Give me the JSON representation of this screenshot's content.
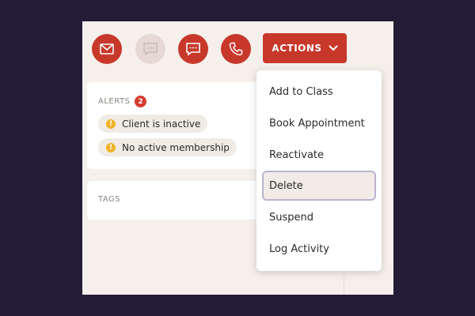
{
  "toolbar": {
    "actions_label": "ACTIONS",
    "sms_label": "SMS",
    "icons": [
      "envelope-icon",
      "sms-icon",
      "chat-icon",
      "phone-icon",
      "chevron-down-icon"
    ],
    "accent_color": "#c8382a"
  },
  "alerts": {
    "label": "ALERTS",
    "count": "2",
    "items": [
      "Client is inactive",
      "No active membership"
    ]
  },
  "tags": {
    "label": "TAGS"
  },
  "menu": {
    "items": [
      "Add to Class",
      "Book Appointment",
      "Reactivate",
      "Delete",
      "Suspend",
      "Log Activity"
    ],
    "highlighted": "Delete"
  }
}
